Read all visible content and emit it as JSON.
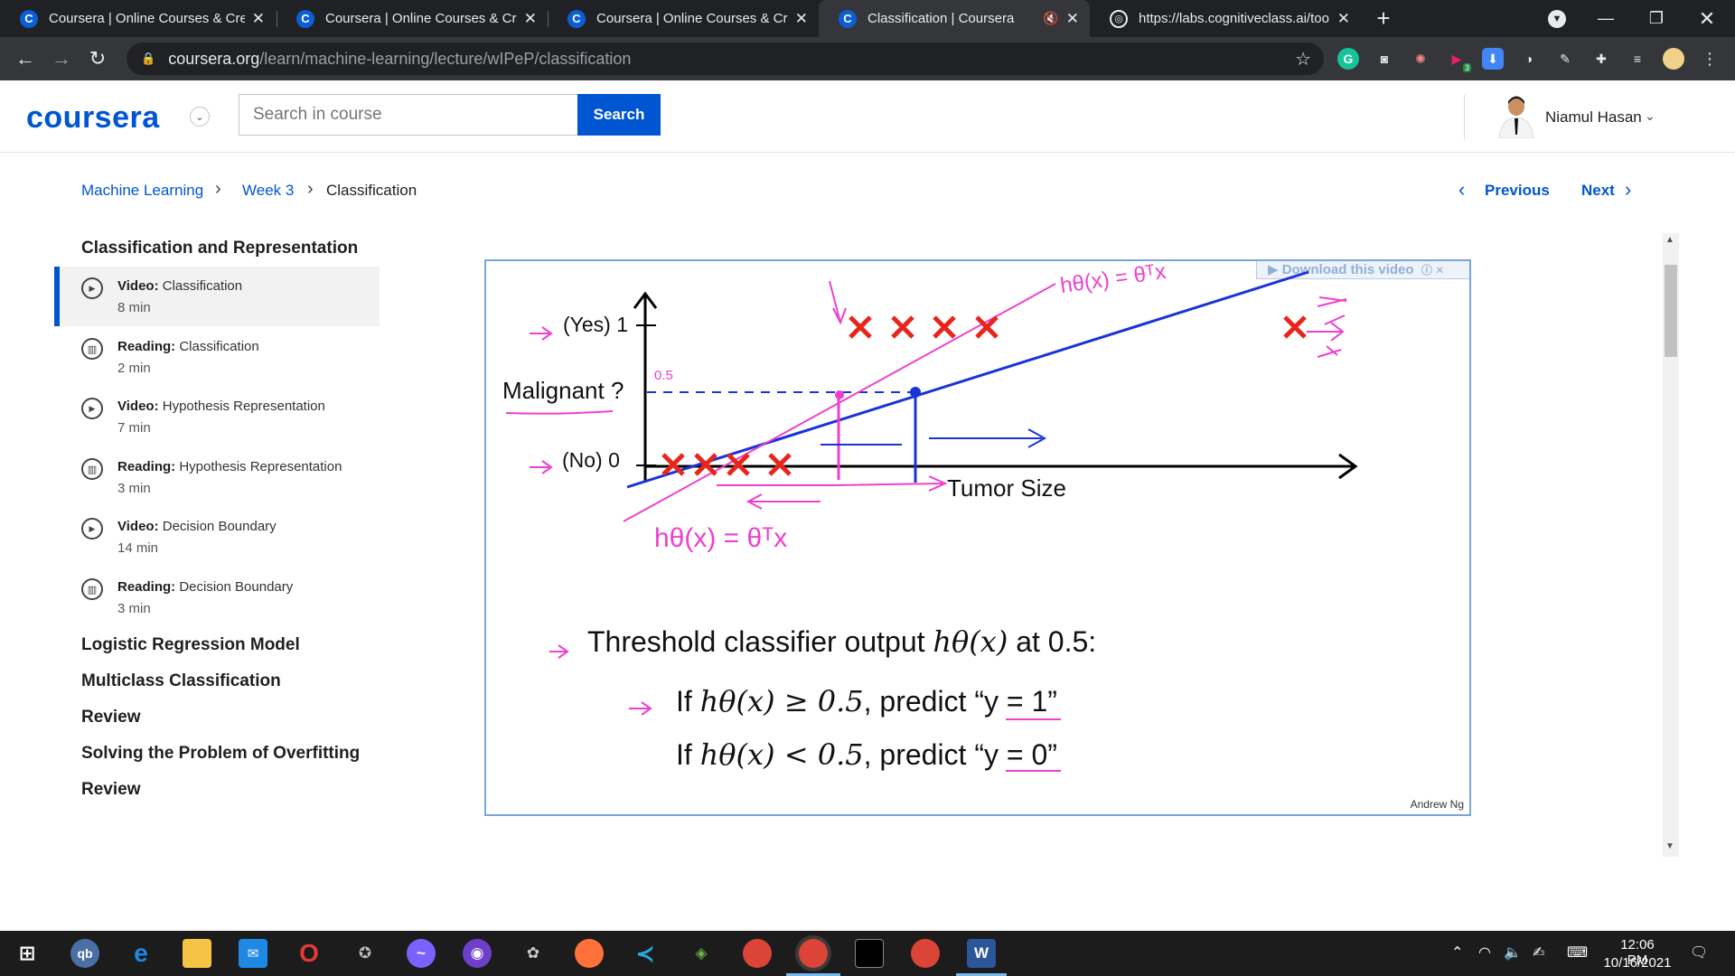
{
  "browser": {
    "tabs": [
      {
        "title": "Coursera | Online Courses & Credentials",
        "favicon": "coursera-icon"
      },
      {
        "title": "Coursera | Online Courses & Credentials",
        "favicon": "coursera-icon"
      },
      {
        "title": "Coursera | Online Courses & Credentials",
        "favicon": "coursera-icon"
      },
      {
        "title": "Classification | Coursera",
        "favicon": "coursera-icon",
        "active": true,
        "muted": true
      },
      {
        "title": "https://labs.cognitiveclass.ai/tools",
        "favicon": "globe-icon"
      }
    ],
    "url_host": "coursera.org",
    "url_path": "/learn/machine-learning/lecture/wIPeP/classification",
    "extension_badge": "3"
  },
  "header": {
    "logo": "coursera",
    "search_placeholder": "Search in course",
    "search_button": "Search",
    "user_name": "Niamul Hasan"
  },
  "breadcrumb": {
    "items": [
      "Machine Learning",
      "Week 3",
      "Classification"
    ]
  },
  "lesson_nav": {
    "previous": "Previous",
    "next": "Next"
  },
  "sidebar": {
    "module_title": "Classification and Representation",
    "items": [
      {
        "type": "Video:",
        "name": "Classification",
        "duration": "8 min",
        "active": true,
        "icon": "play-icon"
      },
      {
        "type": "Reading:",
        "name": "Classification",
        "duration": "2 min",
        "icon": "book-icon"
      },
      {
        "type": "Video:",
        "name": "Hypothesis Representation",
        "duration": "7 min",
        "icon": "play-icon"
      },
      {
        "type": "Reading:",
        "name": "Hypothesis Representation",
        "duration": "3 min",
        "icon": "book-icon"
      },
      {
        "type": "Video:",
        "name": "Decision Boundary",
        "duration": "14 min",
        "icon": "play-icon"
      },
      {
        "type": "Reading:",
        "name": "Decision Boundary",
        "duration": "3 min",
        "icon": "book-icon"
      }
    ],
    "modules": [
      "Logistic Regression Model",
      "Multiclass Classification",
      "Review",
      "Solving the Problem of Overfitting",
      "Review"
    ]
  },
  "video": {
    "download_label": "Download this video",
    "slide": {
      "yes_label": "(Yes) 1",
      "no_label": "(No) 0",
      "y_axis_label": "Malignant ?",
      "x_axis_label": "Tumor Size",
      "threshold_annotation": "0.5",
      "hyp_handwritten_top": "hθ(x) = θᵀx",
      "hyp_handwritten_bottom": "hθ(x) = θᵀx",
      "line1_pre": "Threshold classifier output ",
      "line1_math": "hθ(x)",
      "line1_post": " at 0.5:",
      "line2_pre": "If ",
      "line2_math": "hθ(x) ≥ 0.5",
      "line2_post": ", predict “y = 1”",
      "line3_pre": "If ",
      "line3_math": "hθ(x) < 0.5",
      "line3_post": ", predict “y = 0”",
      "credit": "Andrew Ng"
    }
  },
  "taskbar": {
    "time": "12:06 PM",
    "date": "10/16/2021"
  },
  "colors": {
    "coursera_blue": "#0056d2",
    "slide_pen_pink": "#ee3fd0",
    "slide_pen_blue": "#1a33d6",
    "cross_red": "#e8251c"
  }
}
